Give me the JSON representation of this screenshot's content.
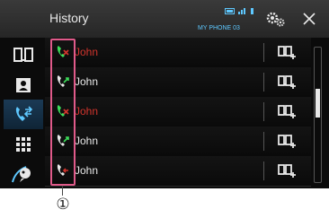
{
  "header": {
    "title": "History",
    "device_name": "MY PHONE 03",
    "status_icons": [
      "battery-icon",
      "signal-icon",
      "bluetooth-icon"
    ],
    "settings_icon": "gear-icon",
    "close_icon": "close-icon"
  },
  "sidebar": {
    "items": [
      {
        "icon": "phonebook-icon",
        "active": false
      },
      {
        "icon": "contacts-icon",
        "active": false
      },
      {
        "icon": "call-history-icon",
        "active": true
      },
      {
        "icon": "keypad-icon",
        "active": false
      },
      {
        "icon": "voice-dial-icon",
        "active": false
      }
    ]
  },
  "history": {
    "rows": [
      {
        "name": "John",
        "call_type": "missed",
        "icon": "missed-call-icon"
      },
      {
        "name": "John",
        "call_type": "outgoing",
        "icon": "outgoing-call-icon"
      },
      {
        "name": "John",
        "call_type": "missed",
        "icon": "missed-call-icon"
      },
      {
        "name": "John",
        "call_type": "outgoing",
        "icon": "outgoing-call-icon"
      },
      {
        "name": "John",
        "call_type": "incoming",
        "icon": "incoming-call-icon"
      }
    ],
    "add_to_phonebook_icon": "add-to-phonebook-icon"
  },
  "scrollbar": {
    "position_fraction": 0.3
  },
  "callout": {
    "label": "①"
  },
  "colors": {
    "accent": "#5ec8ff",
    "missed": "#d0342c",
    "outgoing": "#3ddc5a",
    "incoming": "#d0342c",
    "highlight": "#e05a8a"
  }
}
